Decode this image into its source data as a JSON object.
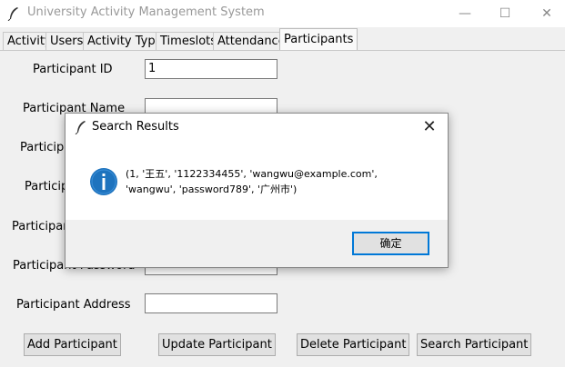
{
  "window": {
    "title": "University Activity Management System",
    "minimize": "—",
    "maximize": "☐",
    "close": "✕"
  },
  "tabs": [
    {
      "label": "Activity"
    },
    {
      "label": "Users"
    },
    {
      "label": "Activity Type"
    },
    {
      "label": "Timeslots"
    },
    {
      "label": "Attendance"
    },
    {
      "label": "Participants",
      "active": true
    }
  ],
  "form": {
    "id_label": "Participant ID",
    "id_value": "1",
    "name_label": "Participant Name",
    "row3_label_visible": "Participa",
    "row4_label_visible": "Participa",
    "row5_label_visible": "Participant",
    "row6_label_visible": "Participant Password",
    "address_label": "Participant Address",
    "address_value": ""
  },
  "buttons": {
    "add": "Add Participant",
    "update": "Update Participant",
    "delete": "Delete Participant",
    "search": "Search Participant"
  },
  "dialog": {
    "title": "Search Results",
    "close": "✕",
    "message": "(1, '王五', '1122334455', 'wangwu@example.com', 'wangwu', 'password789', '广州市')",
    "ok": "确定",
    "icon": "info-icon"
  },
  "colors": {
    "accent": "#0078d7",
    "info_icon": "#1e73be",
    "window_bg": "#f0f0f0"
  }
}
